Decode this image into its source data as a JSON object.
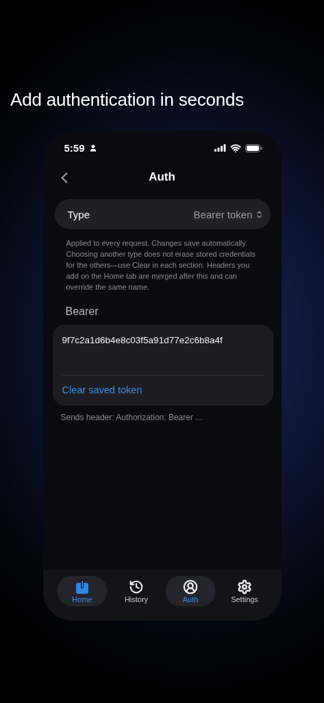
{
  "headline": "Add authentication in seconds",
  "status_bar": {
    "time": "5:59"
  },
  "nav": {
    "title": "Auth"
  },
  "type_row": {
    "label": "Type",
    "value": "Bearer token"
  },
  "help_text": "Applied to every request. Changes save automatically. Choosing another type does not erase stored credentials for the others—use Clear in each section. Headers you add on the Home tab are merged after this and can override the same name.",
  "section": {
    "title": "Bearer",
    "token": "9f7c2a1d6b4e8c03f5a91d77e2c6b8a4f",
    "clear_link": "Clear saved token",
    "footer": "Sends header: Authorization: Bearer ..."
  },
  "tabs": [
    {
      "kind": "home",
      "label": "Home",
      "selected": true,
      "icon_tinted": true
    },
    {
      "kind": "history",
      "label": "History",
      "selected": false,
      "icon_tinted": false
    },
    {
      "kind": "auth",
      "label": "Auth",
      "selected": true,
      "icon_tinted": false
    },
    {
      "kind": "settings",
      "label": "Settings",
      "selected": false,
      "icon_tinted": false
    }
  ]
}
